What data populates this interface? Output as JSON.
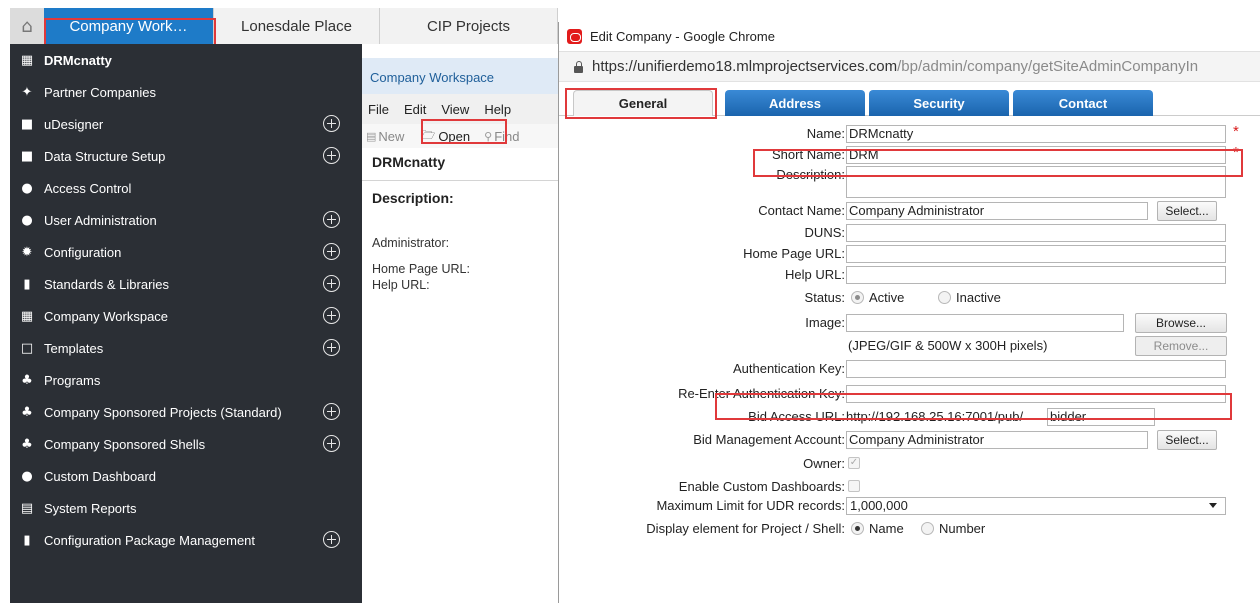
{
  "top_tabs": [
    {
      "label": "Company Work…",
      "active": true
    },
    {
      "label": "Lonesdale Place",
      "active": false
    },
    {
      "label": "CIP Projects",
      "active": false
    }
  ],
  "home_icon": "home-icon",
  "sidebar": {
    "items": [
      {
        "label": "DRMcnatty",
        "icon": "building-icon",
        "glyph": "▦",
        "expandable": false,
        "header": true
      },
      {
        "label": "Partner Companies",
        "icon": "handshake-icon",
        "glyph": "✦",
        "expandable": false
      },
      {
        "label": "uDesigner",
        "icon": "square-icon",
        "glyph": "■",
        "expandable": true
      },
      {
        "label": "Data Structure Setup",
        "icon": "square-icon",
        "glyph": "■",
        "expandable": true
      },
      {
        "label": "Access Control",
        "icon": "users-icon",
        "glyph": "●",
        "expandable": false
      },
      {
        "label": "User Administration",
        "icon": "users-icon",
        "glyph": "●",
        "expandable": true
      },
      {
        "label": "Configuration",
        "icon": "gear-icon",
        "glyph": "✹",
        "expandable": true
      },
      {
        "label": "Standards & Libraries",
        "icon": "book-icon",
        "glyph": "▮",
        "expandable": true
      },
      {
        "label": "Company Workspace",
        "icon": "building-icon",
        "glyph": "▦",
        "expandable": true
      },
      {
        "label": "Templates",
        "icon": "document-icon",
        "glyph": "□",
        "expandable": true
      },
      {
        "label": "Programs",
        "icon": "sitemap-icon",
        "glyph": "♣",
        "expandable": false
      },
      {
        "label": "Company Sponsored Projects (Standard)",
        "icon": "sitemap-icon",
        "glyph": "♣",
        "expandable": true
      },
      {
        "label": "Company Sponsored Shells",
        "icon": "sitemap-icon",
        "glyph": "♣",
        "expandable": true
      },
      {
        "label": "Custom Dashboard",
        "icon": "dashboard-icon",
        "glyph": "●",
        "expandable": false
      },
      {
        "label": "System Reports",
        "icon": "report-icon",
        "glyph": "▤",
        "expandable": false
      },
      {
        "label": "Configuration Package Management",
        "icon": "package-icon",
        "glyph": "▮",
        "expandable": true
      }
    ]
  },
  "workspace": {
    "title": "Company Workspace",
    "menu": [
      "File",
      "Edit",
      "View",
      "Help"
    ],
    "toolbar": {
      "new": "New",
      "open": "Open",
      "find": "Find"
    },
    "company_name": "DRMcnatty",
    "description_label": "Description:",
    "fields": [
      "Administrator:",
      "Home Page URL:",
      "Help URL:"
    ]
  },
  "popup": {
    "window_title": "Edit Company - Google Chrome",
    "url_host": "https://unifierdemo18.mlmprojectservices.com",
    "url_path": "/bp/admin/company/getSiteAdminCompanyIn",
    "tabs": [
      "General",
      "Address",
      "Security",
      "Contact"
    ],
    "form": {
      "name_label": "Name:",
      "name_value": "DRMcnatty",
      "short_name_label": "Short Name:",
      "short_name_value": "DRM",
      "description_label": "Description:",
      "contact_name_label": "Contact Name:",
      "contact_name_value": "Company Administrator",
      "select_label": "Select...",
      "duns_label": "DUNS:",
      "home_page_url_label": "Home Page URL:",
      "help_url_label": "Help URL:",
      "status_label": "Status:",
      "status_active": "Active",
      "status_inactive": "Inactive",
      "image_label": "Image:",
      "browse_label": "Browse...",
      "image_note": "(JPEG/GIF & 500W x 300H pixels)",
      "remove_label": "Remove...",
      "auth_key_label": "Authentication Key:",
      "reenter_auth_key_label": "Re-Enter Authentication Key:",
      "bid_access_url_label": "Bid Access URL:",
      "bid_access_url_prefix": "http://192.168.25.16:7001/pub/",
      "bid_access_url_value": "bidder",
      "bid_mgmt_account_label": "Bid Management Account:",
      "bid_mgmt_account_value": "Company Administrator",
      "owner_label": "Owner:",
      "enable_dashboards_label": "Enable Custom Dashboards:",
      "max_udr_label": "Maximum Limit for UDR records:",
      "max_udr_value": "1,000,000",
      "display_element_label": "Display element for Project / Shell:",
      "display_name": "Name",
      "display_number": "Number",
      "required_mark": "*"
    }
  },
  "colors": {
    "accent": "#1e7bc8",
    "sidebar_bg": "#2b2f35",
    "highlight": "#e0393b",
    "tab_blue": "#1a64ad"
  }
}
